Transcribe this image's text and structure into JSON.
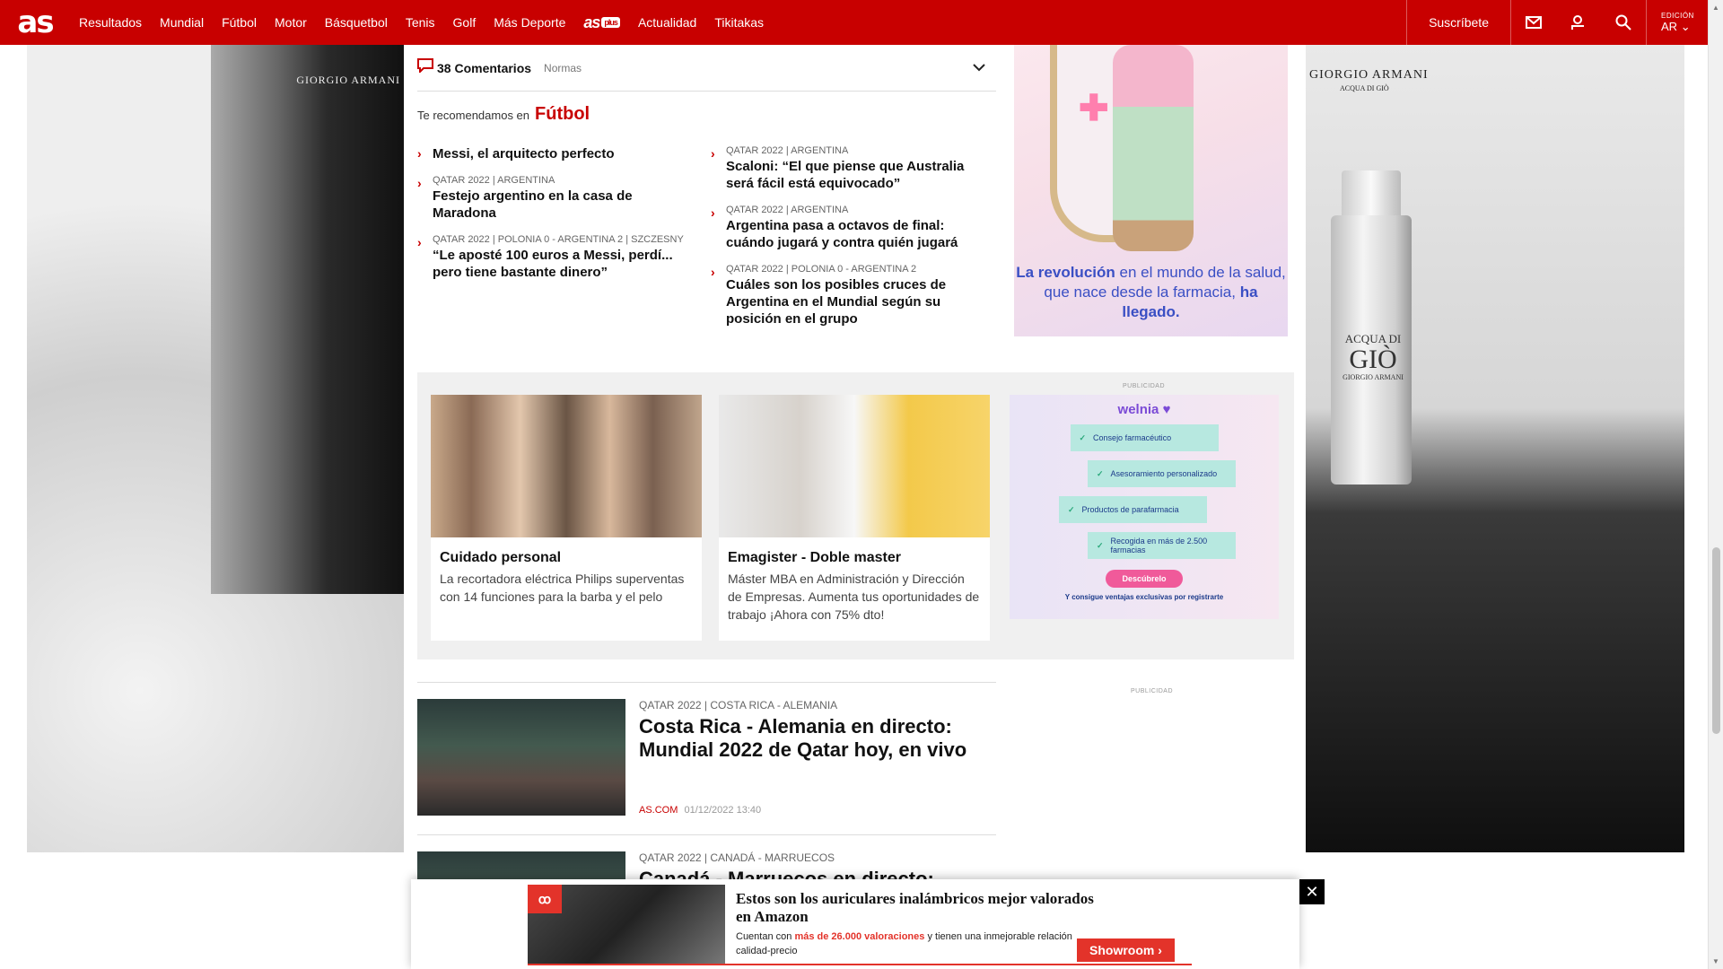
{
  "nav": {
    "logo": "as",
    "items": [
      "Resultados",
      "Mundial",
      "Fútbol",
      "Motor",
      "Básquetbol",
      "Tenis",
      "Golf",
      "Más Deporte"
    ],
    "brand_item": "as",
    "brand_badge": "plus",
    "items_after": [
      "Actualidad",
      "Tikitakas"
    ],
    "subscribe": "Suscríbete",
    "edition_label": "EDICIÓN",
    "edition_value": "AR",
    "icons": [
      "mail-icon",
      "user-icon",
      "search-icon",
      "chevron-down-icon"
    ],
    "accent": "#c80000"
  },
  "ads": {
    "left_brand": "GIORGIO ARMANI",
    "right_brand": "GIORGIO ARMANI",
    "right_brand_sub": "ACQUA DI GIÒ",
    "bottle_line1": "ACQUA DI",
    "bottle_line2": "GIÒ",
    "bottle_line3": "GIORGIO ARMANI",
    "top_right_text1": "La revolución",
    "top_right_text2": "en el mundo de la salud, que nace desde la farmacia,",
    "top_right_text3": "ha llegado."
  },
  "comments": {
    "count": "38 Comentarios",
    "rules": "Normas"
  },
  "recommend": {
    "intro": "Te recomendamos en",
    "section": "Fútbol",
    "left": [
      {
        "kicker": "",
        "headline": "Messi, el arquitecto perfecto"
      },
      {
        "kicker": "QATAR 2022 | ARGENTINA",
        "headline": "Festejo argentino en la casa de Maradona"
      },
      {
        "kicker": "QATAR 2022 | POLONIA 0 - ARGENTINA 2 | SZCZESNY",
        "headline": "“Le aposté 100 euros a Messi, perdí... pero tiene bastante dinero”"
      }
    ],
    "right": [
      {
        "kicker": "QATAR 2022 | ARGENTINA",
        "headline": "Scaloni: “El que piense que Australia será fácil está equivocado”"
      },
      {
        "kicker": "QATAR 2022 | ARGENTINA",
        "headline": "Argentina pasa a octavos de final: cuándo jugará y contra quién jugará"
      },
      {
        "kicker": "QATAR 2022 | POLONIA 0 - ARGENTINA 2",
        "headline": "Cuáles son los posibles cruces de Argentina en el Mundial según su posición en el grupo"
      }
    ]
  },
  "promos": {
    "label": "PUBLICIDAD",
    "cards": [
      {
        "title": "Cuidado personal",
        "desc": "La recortadora eléctrica Philips superventas con 14 funciones para la barba y el pelo"
      },
      {
        "title": "Emagister - Doble master",
        "desc": "Máster MBA en Administración y Dirección de Empresas. Aumenta tus oportunidades de trabajo ¡Ahora con 75% dto!"
      }
    ],
    "welnia": {
      "logo": "welnia",
      "chips": [
        "Consejo farmacéutico",
        "Asesoramiento personalizado",
        "Productos de parafarmacia",
        "Recogida en más de 2.500 farmacias"
      ],
      "button": "Descúbrelo",
      "footer": "Y consigue ventajas exclusivas por registrarte"
    }
  },
  "articles": [
    {
      "kicker": "QATAR 2022 | COSTA RICA - ALEMANIA",
      "headline": "Costa Rica - Alemania en directo: Mundial 2022 de Qatar hoy, en vivo",
      "source": "AS.COM",
      "date": "01/12/2022",
      "time": "13:40"
    },
    {
      "kicker": "QATAR 2022 | CANADÁ - MARRUECOS",
      "headline": "Canadá - Marruecos en directo:",
      "source": "",
      "date": "",
      "time": ""
    }
  ],
  "right_pub_label": "PUBLICIDAD",
  "float_ad": {
    "badge": "ꝏ",
    "title": "Estos son los auriculares inalámbricos mejor valorados en Amazon",
    "desc_pre": "Cuentan con",
    "desc_highlight": "más de 26.000 valoraciones",
    "desc_post": "y tienen una inmejorable relación calidad-precio",
    "cta": "Showroom ›",
    "close": "✕"
  }
}
